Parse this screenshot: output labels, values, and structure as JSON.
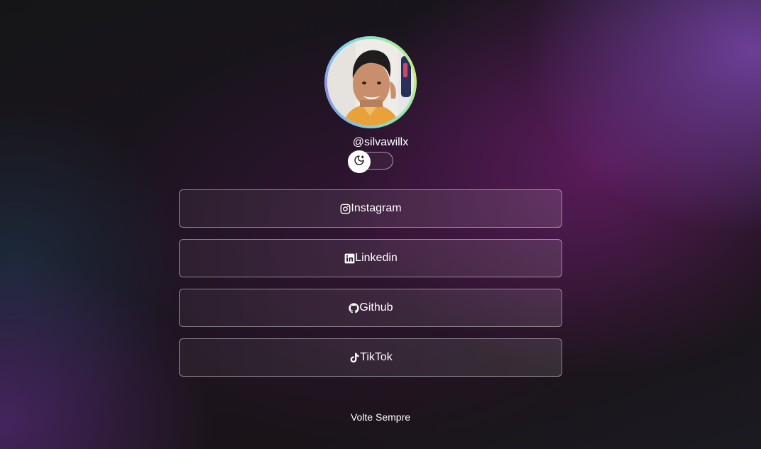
{
  "profile": {
    "username": "@silvawillx",
    "avatar_ring_colors": [
      "#7dc5e8",
      "#8f8ee6",
      "#9be8a8",
      "#c5f07a"
    ]
  },
  "theme_toggle": {
    "icon": "moon-stars-icon",
    "state": "dark"
  },
  "links": [
    {
      "label": "Instagram",
      "icon": "instagram-icon"
    },
    {
      "label": "Linkedin",
      "icon": "linkedin-icon"
    },
    {
      "label": "Github",
      "icon": "github-icon"
    },
    {
      "label": "TikTok",
      "icon": "tiktok-icon"
    }
  ],
  "footer": {
    "text": "Volte Sempre"
  }
}
